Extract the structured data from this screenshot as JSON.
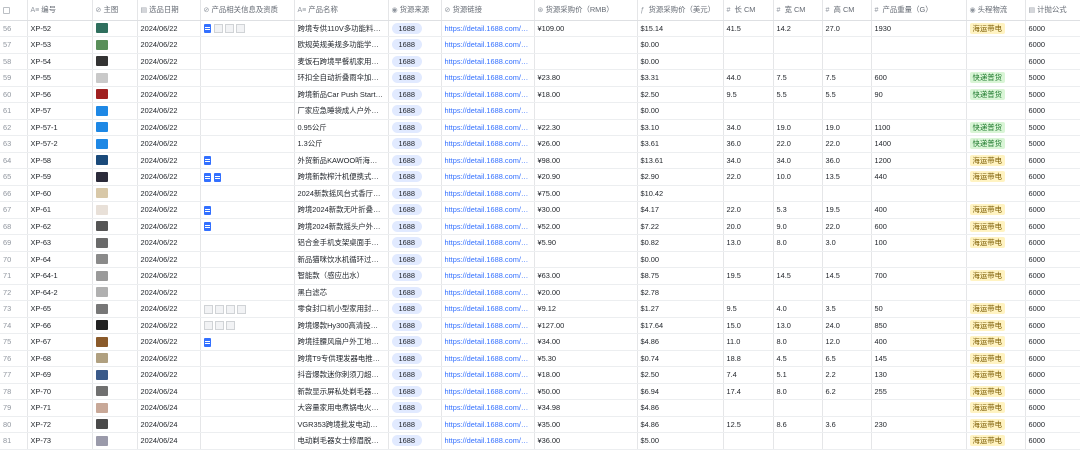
{
  "columns": [
    {
      "icon": "",
      "label": ""
    },
    {
      "icon": "A≡",
      "label": "编号"
    },
    {
      "icon": "⊘",
      "label": "主图"
    },
    {
      "icon": "▤",
      "label": "选品日期"
    },
    {
      "icon": "⊘",
      "label": "产品相关信息及资质"
    },
    {
      "icon": "A≡",
      "label": "产品名称"
    },
    {
      "icon": "◉",
      "label": "货源来源"
    },
    {
      "icon": "⊘",
      "label": "货源链接"
    },
    {
      "icon": "⊛",
      "label": "货源采购价（RMB）"
    },
    {
      "icon": "ƒ",
      "label": "货源采购价（美元）"
    },
    {
      "icon": "#",
      "label": "长 CM"
    },
    {
      "icon": "#",
      "label": "宽 CM"
    },
    {
      "icon": "#",
      "label": "高 CM"
    },
    {
      "icon": "#",
      "label": "产品重量（G）"
    },
    {
      "icon": "◉",
      "label": "头程物流"
    },
    {
      "icon": "▤",
      "label": "计抛公式"
    }
  ],
  "colors": {
    "accent": "#3370ff",
    "tag_bg": "#e1eaff",
    "sea_bg": "#fff3c2",
    "express_bg": "#d9f5d6"
  },
  "rows": [
    {
      "n": "56",
      "code": "XP-52",
      "img": "#2f6f5e",
      "date": "2024/06/22",
      "docs": 1,
      "thumbs": 3,
      "name": "跨境专供110V多功能料…",
      "src": "1688",
      "link": "https://detail.1688.com/…",
      "rmb": "¥109.00",
      "usd": "$15.14",
      "l": "41.5",
      "w": "14.2",
      "h": "27.0",
      "g": "1930",
      "log": "海运带电",
      "f": "6000"
    },
    {
      "n": "57",
      "code": "XP-53",
      "img": "#5a8f5a",
      "date": "2024/06/22",
      "docs": 0,
      "thumbs": 0,
      "name": "欧规英规美规多功能学…",
      "src": "1688",
      "link": "https://detail.1688.com/…",
      "rmb": "",
      "usd": "$0.00",
      "l": "",
      "w": "",
      "h": "",
      "g": "",
      "log": "",
      "f": "6000"
    },
    {
      "n": "58",
      "code": "XP-54",
      "img": "#333333",
      "date": "2024/06/22",
      "docs": 0,
      "thumbs": 0,
      "name": "麦饭石跨境早餐机家用…",
      "src": "1688",
      "link": "https://detail.1688.com/…",
      "rmb": "",
      "usd": "$0.00",
      "l": "",
      "w": "",
      "h": "",
      "g": "",
      "log": "",
      "f": "6000"
    },
    {
      "n": "59",
      "code": "XP-55",
      "img": "#c9c9c9",
      "date": "2024/06/22",
      "docs": 0,
      "thumbs": 0,
      "name": "环扣全自动折叠雨伞加…",
      "src": "1688",
      "link": "https://detail.1688.com/…",
      "rmb": "¥23.80",
      "usd": "$3.31",
      "l": "44.0",
      "w": "7.5",
      "h": "7.5",
      "g": "600",
      "log": "快递普货",
      "f": "5000"
    },
    {
      "n": "60",
      "code": "XP-56",
      "img": "#a02020",
      "date": "2024/06/22",
      "docs": 0,
      "thumbs": 0,
      "name": "跨境新品Car Push Start …",
      "src": "1688",
      "link": "https://detail.1688.com/…",
      "rmb": "¥18.00",
      "usd": "$2.50",
      "l": "9.5",
      "w": "5.5",
      "h": "5.5",
      "g": "90",
      "log": "快递普货",
      "f": "5000"
    },
    {
      "n": "61",
      "code": "XP-57",
      "img": "#1e88e5",
      "date": "2024/06/22",
      "docs": 0,
      "thumbs": 0,
      "name": "厂家应急睡袋成人户外…",
      "src": "1688",
      "link": "https://detail.1688.com/…",
      "rmb": "",
      "usd": "$0.00",
      "l": "",
      "w": "",
      "h": "",
      "g": "",
      "log": "",
      "f": "6000"
    },
    {
      "n": "62",
      "code": "XP-57-1",
      "img": "#1e88e5",
      "date": "2024/06/22",
      "docs": 0,
      "thumbs": 0,
      "name": "0.95公斤",
      "src": "1688",
      "link": "https://detail.1688.com/…",
      "rmb": "¥22.30",
      "usd": "$3.10",
      "l": "34.0",
      "w": "19.0",
      "h": "19.0",
      "g": "1100",
      "log": "快递普货",
      "f": "5000"
    },
    {
      "n": "63",
      "code": "XP-57-2",
      "img": "#1e88e5",
      "date": "2024/06/22",
      "docs": 0,
      "thumbs": 0,
      "name": "1.3公斤",
      "src": "1688",
      "link": "https://detail.1688.com/…",
      "rmb": "¥26.00",
      "usd": "$3.61",
      "l": "36.0",
      "w": "22.0",
      "h": "22.0",
      "g": "1400",
      "log": "快递普货",
      "f": "5000"
    },
    {
      "n": "64",
      "code": "XP-58",
      "img": "#1a4a7a",
      "date": "2024/06/22",
      "docs": 1,
      "thumbs": 0,
      "name": "外贸新品KAWOO听海无…",
      "src": "1688",
      "link": "https://detail.1688.com/…",
      "rmb": "¥98.00",
      "usd": "$13.61",
      "l": "34.0",
      "w": "34.0",
      "h": "36.0",
      "g": "1200",
      "log": "海运带电",
      "f": "6000"
    },
    {
      "n": "65",
      "code": "XP-59",
      "img": "#2b2b3a",
      "date": "2024/06/22",
      "docs": 2,
      "thumbs": 0,
      "name": "跨境新款榨汁机便携式…",
      "src": "1688",
      "link": "https://detail.1688.com/…",
      "rmb": "¥20.90",
      "usd": "$2.90",
      "l": "22.0",
      "w": "10.0",
      "h": "13.5",
      "g": "440",
      "log": "海运带电",
      "f": "6000"
    },
    {
      "n": "66",
      "code": "XP-60",
      "img": "#d8c8a8",
      "date": "2024/06/22",
      "docs": 0,
      "thumbs": 0,
      "name": "2024新款摇风台式香厅…",
      "src": "1688",
      "link": "https://detail.1688.com/…",
      "rmb": "¥75.00",
      "usd": "$10.42",
      "l": "",
      "w": "",
      "h": "",
      "g": "",
      "log": "",
      "f": "6000"
    },
    {
      "n": "67",
      "code": "XP-61",
      "img": "#e8e0d8",
      "date": "2024/06/22",
      "docs": 1,
      "thumbs": 0,
      "name": "跨境2024新款无叶折叠…",
      "src": "1688",
      "link": "https://detail.1688.com/…",
      "rmb": "¥30.00",
      "usd": "$4.17",
      "l": "22.0",
      "w": "5.3",
      "h": "19.5",
      "g": "400",
      "log": "海运带电",
      "f": "6000"
    },
    {
      "n": "68",
      "code": "XP-62",
      "img": "#555555",
      "date": "2024/06/22",
      "docs": 1,
      "thumbs": 0,
      "name": "跨境2024新款摇头户外…",
      "src": "1688",
      "link": "https://detail.1688.com/…",
      "rmb": "¥52.00",
      "usd": "$7.22",
      "l": "20.0",
      "w": "9.0",
      "h": "22.0",
      "g": "600",
      "log": "海运带电",
      "f": "6000"
    },
    {
      "n": "69",
      "code": "XP-63",
      "img": "#6a6a6a",
      "date": "2024/06/22",
      "docs": 0,
      "thumbs": 0,
      "name": "铝合金手机支架桌面手…",
      "src": "1688",
      "link": "https://detail.1688.com/…",
      "rmb": "¥5.90",
      "usd": "$0.82",
      "l": "13.0",
      "w": "8.0",
      "h": "3.0",
      "g": "100",
      "log": "海运带电",
      "f": "6000"
    },
    {
      "n": "70",
      "code": "XP-64",
      "img": "#8a8a8a",
      "date": "2024/06/22",
      "docs": 0,
      "thumbs": 0,
      "name": "新品猫咪饮水机循环过…",
      "src": "1688",
      "link": "https://detail.1688.com/…",
      "rmb": "",
      "usd": "$0.00",
      "l": "",
      "w": "",
      "h": "",
      "g": "",
      "log": "",
      "f": "6000"
    },
    {
      "n": "71",
      "code": "XP-64-1",
      "img": "#9a9a9a",
      "date": "2024/06/22",
      "docs": 0,
      "thumbs": 0,
      "name": "智能款（感应出水）",
      "src": "1688",
      "link": "https://detail.1688.com/…",
      "rmb": "¥63.00",
      "usd": "$8.75",
      "l": "19.5",
      "w": "14.5",
      "h": "14.5",
      "g": "700",
      "log": "海运带电",
      "f": "6000"
    },
    {
      "n": "72",
      "code": "XP-64-2",
      "img": "#b0b0b0",
      "date": "2024/06/22",
      "docs": 0,
      "thumbs": 0,
      "name": "黑白滤芯",
      "src": "1688",
      "link": "https://detail.1688.com/…",
      "rmb": "¥20.00",
      "usd": "$2.78",
      "l": "",
      "w": "",
      "h": "",
      "g": "",
      "log": "",
      "f": "6000"
    },
    {
      "n": "73",
      "code": "XP-65",
      "img": "#777777",
      "date": "2024/06/22",
      "docs": 0,
      "thumbs": 4,
      "name": "零食封口机小型家用封…",
      "src": "1688",
      "link": "https://detail.1688.com/…",
      "rmb": "¥9.12",
      "usd": "$1.27",
      "l": "9.5",
      "w": "4.0",
      "h": "3.5",
      "g": "50",
      "log": "海运带电",
      "f": "6000"
    },
    {
      "n": "74",
      "code": "XP-66",
      "img": "#222222",
      "date": "2024/06/22",
      "docs": 0,
      "thumbs": 3,
      "name": "跨境爆款Hy300高清投…",
      "src": "1688",
      "link": "https://detail.1688.com/…",
      "rmb": "¥127.00",
      "usd": "$17.64",
      "l": "15.0",
      "w": "13.0",
      "h": "24.0",
      "g": "850",
      "log": "海运带电",
      "f": "6000"
    },
    {
      "n": "75",
      "code": "XP-67",
      "img": "#8a5a2a",
      "date": "2024/06/22",
      "docs": 1,
      "thumbs": 0,
      "name": "跨境挂腰风扇户外工地…",
      "src": "1688",
      "link": "https://detail.1688.com/…",
      "rmb": "¥34.00",
      "usd": "$4.86",
      "l": "11.0",
      "w": "8.0",
      "h": "12.0",
      "g": "400",
      "log": "海运带电",
      "f": "6000"
    },
    {
      "n": "76",
      "code": "XP-68",
      "img": "#b0a080",
      "date": "2024/06/22",
      "docs": 0,
      "thumbs": 0,
      "name": "跨境T9专供理发器电推…",
      "src": "1688",
      "link": "https://detail.1688.com/…",
      "rmb": "¥5.30",
      "usd": "$0.74",
      "l": "18.8",
      "w": "4.5",
      "h": "6.5",
      "g": "145",
      "log": "海运带电",
      "f": "6000"
    },
    {
      "n": "77",
      "code": "XP-69",
      "img": "#3a5a8a",
      "date": "2024/06/22",
      "docs": 0,
      "thumbs": 0,
      "name": "抖音爆款迷你刺须刀超…",
      "src": "1688",
      "link": "https://detail.1688.com/…",
      "rmb": "¥18.00",
      "usd": "$2.50",
      "l": "7.4",
      "w": "5.1",
      "h": "2.2",
      "g": "130",
      "log": "海运带电",
      "f": "6000"
    },
    {
      "n": "78",
      "code": "XP-70",
      "img": "#707070",
      "date": "2024/06/24",
      "docs": 0,
      "thumbs": 0,
      "name": "新款显示屏私处剃毛器…",
      "src": "1688",
      "link": "https://detail.1688.com/…",
      "rmb": "¥50.00",
      "usd": "$6.94",
      "l": "17.4",
      "w": "8.0",
      "h": "6.2",
      "g": "255",
      "log": "海运带电",
      "f": "6000"
    },
    {
      "n": "79",
      "code": "XP-71",
      "img": "#c8a898",
      "date": "2024/06/24",
      "docs": 0,
      "thumbs": 0,
      "name": "大容量家用电煮锅电火…",
      "src": "1688",
      "link": "https://detail.1688.com/…",
      "rmb": "¥34.98",
      "usd": "$4.86",
      "l": "",
      "w": "",
      "h": "",
      "g": "",
      "log": "海运带电",
      "f": "6000"
    },
    {
      "n": "80",
      "code": "XP-72",
      "img": "#4a4a4a",
      "date": "2024/06/24",
      "docs": 0,
      "thumbs": 0,
      "name": "VGR353跨境批发电动剃…",
      "src": "1688",
      "link": "https://detail.1688.com/…",
      "rmb": "¥35.00",
      "usd": "$4.86",
      "l": "12.5",
      "w": "8.6",
      "h": "3.6",
      "g": "230",
      "log": "海运带电",
      "f": "6000"
    },
    {
      "n": "81",
      "code": "XP-73",
      "img": "#9a9aaa",
      "date": "2024/06/24",
      "docs": 0,
      "thumbs": 0,
      "name": "电动剃毛器女士修眉脱…",
      "src": "1688",
      "link": "https://detail.1688.com/…",
      "rmb": "¥36.00",
      "usd": "$5.00",
      "l": "",
      "w": "",
      "h": "",
      "g": "",
      "log": "海运带电",
      "f": "6000"
    }
  ]
}
